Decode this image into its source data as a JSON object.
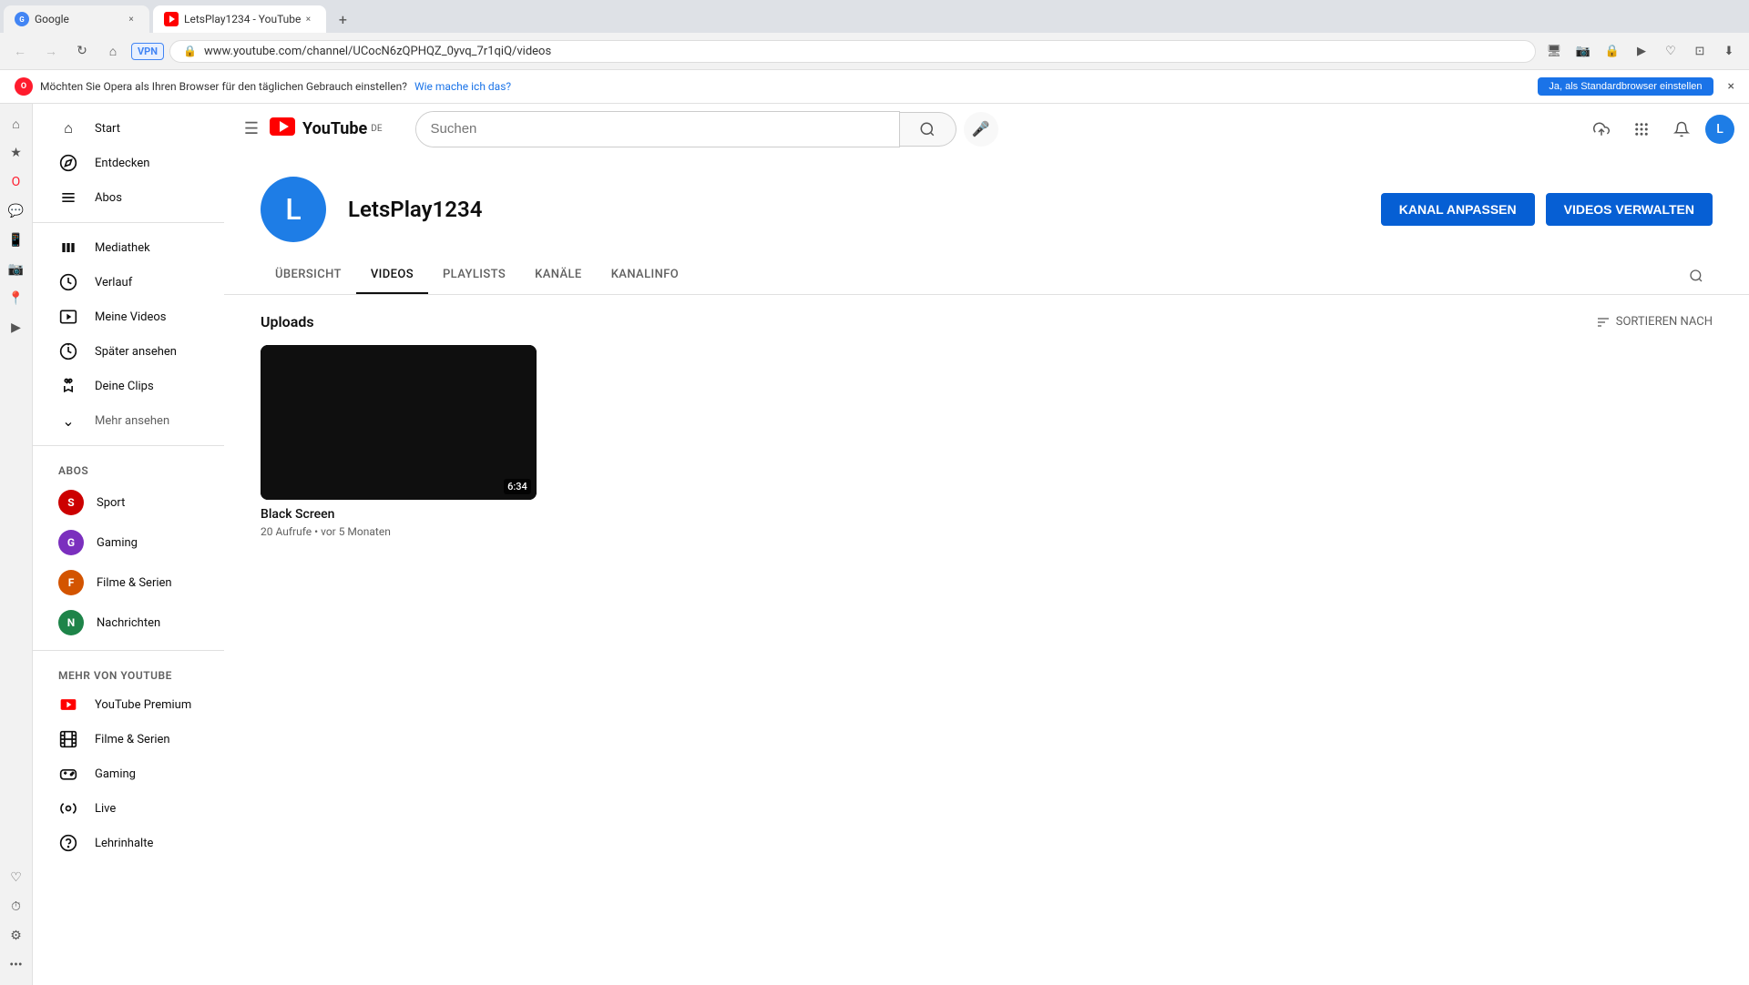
{
  "browser": {
    "tabs": [
      {
        "id": "google-tab",
        "title": "Google",
        "icon": "G",
        "active": false
      },
      {
        "id": "yt-tab",
        "title": "LetsPlay1234 - YouTube",
        "icon": "▶",
        "active": true
      }
    ],
    "address": "www.youtube.com/channel/UCocN6zQPHQZ_0yvq_7r1qiQ/videos",
    "address_full": "https://www.youtube.com/channel/UCocN6zQPHQZ_0yvq_7r1qiQ/videos",
    "vpn_label": "VPN"
  },
  "opera_prompt": {
    "text": "Möchten Sie Opera als Ihren Browser für den täglichen Gebrauch einstellen?",
    "link_text": "Wie mache ich das?",
    "button_label": "Ja, als Standardbrowser einstellen",
    "close": "×"
  },
  "youtube": {
    "logo_text": "YouTube",
    "logo_country": "DE",
    "search_placeholder": "Suchen",
    "header_actions": {
      "upload_label": "Upload",
      "apps_label": "Apps",
      "notifications_label": "Notifications",
      "account_label": "L"
    },
    "sidebar": {
      "nav_items": [
        {
          "id": "start",
          "label": "Start",
          "icon": "⌂"
        },
        {
          "id": "entdecken",
          "label": "Entdecken",
          "icon": "🔥"
        },
        {
          "id": "abos",
          "label": "Abos",
          "icon": "≡"
        }
      ],
      "library_items": [
        {
          "id": "mediathek",
          "label": "Mediathek",
          "icon": "📚"
        },
        {
          "id": "verlauf",
          "label": "Verlauf",
          "icon": "↺"
        },
        {
          "id": "meine-videos",
          "label": "Meine Videos",
          "icon": "▶"
        },
        {
          "id": "spaeter-ansehen",
          "label": "Später ansehen",
          "icon": "◷"
        },
        {
          "id": "deine-clips",
          "label": "Deine Clips",
          "icon": "✂"
        }
      ],
      "mehr_ansehen_label": "Mehr ansehen",
      "abos_section_title": "ABOS",
      "abos_items": [
        {
          "id": "sport",
          "label": "Sport",
          "color": "#f00",
          "letter": "S"
        },
        {
          "id": "gaming",
          "label": "Gaming",
          "color": "#9b59b6",
          "letter": "G"
        },
        {
          "id": "filme-serien",
          "label": "Filme & Serien",
          "color": "#e67e22",
          "letter": "F"
        },
        {
          "id": "nachrichten",
          "label": "Nachrichten",
          "color": "#27ae60",
          "letter": "N"
        }
      ],
      "mehr_von_youtube_title": "MEHR VON YOUTUBE",
      "mehr_von_youtube_items": [
        {
          "id": "youtube-premium",
          "label": "YouTube Premium",
          "icon": "▶"
        },
        {
          "id": "filme-serien-2",
          "label": "Filme & Serien",
          "icon": "🎬"
        },
        {
          "id": "gaming-2",
          "label": "Gaming",
          "icon": "🎮"
        },
        {
          "id": "live",
          "label": "Live",
          "icon": "📡"
        },
        {
          "id": "lehrinhalte",
          "label": "Lehrinhalte",
          "icon": "💡"
        }
      ]
    },
    "channel": {
      "avatar_letter": "L",
      "name": "LetsPlay1234",
      "customize_btn": "KANAL ANPASSEN",
      "manage_btn": "VIDEOS VERWALTEN",
      "tabs": [
        {
          "id": "ubersicht",
          "label": "ÜBERSICHT",
          "active": false
        },
        {
          "id": "videos",
          "label": "VIDEOS",
          "active": true
        },
        {
          "id": "playlists",
          "label": "PLAYLISTS",
          "active": false
        },
        {
          "id": "kanale",
          "label": "KANÄLE",
          "active": false
        },
        {
          "id": "kanalinfo",
          "label": "KANALINFO",
          "active": false
        }
      ]
    },
    "videos_section": {
      "uploads_label": "Uploads",
      "sort_label": "SORTIEREN NACH",
      "videos": [
        {
          "id": "black-screen",
          "title": "Black Screen",
          "duration": "6:34",
          "views": "20 Aufrufe",
          "time_ago": "vor 5 Monaten",
          "meta": "20 Aufrufe • vor 5 Monaten"
        }
      ]
    }
  }
}
